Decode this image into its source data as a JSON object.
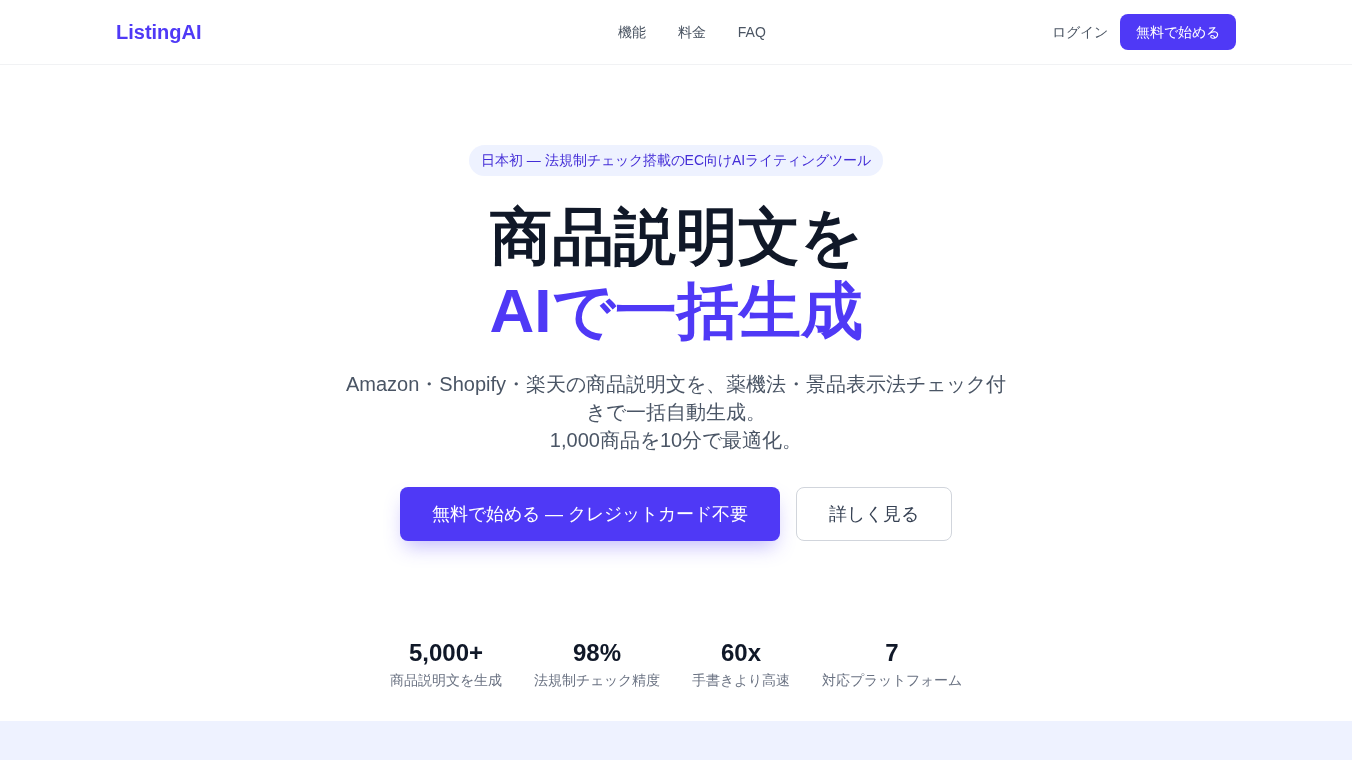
{
  "header": {
    "logo": "ListingAI",
    "nav": [
      "機能",
      "料金",
      "FAQ"
    ],
    "login": "ログイン",
    "cta": "無料で始める"
  },
  "hero": {
    "badge": "日本初 — 法規制チェック搭載のEC向けAIライティングツール",
    "heading": [
      {
        "text": "商品説明文を",
        "accent": false
      },
      {
        "text": "AIで一括生成",
        "accent": true
      }
    ],
    "subtitle": [
      "Amazon・Shopify・楽天の商品説明文を、薬機法・景品表示法チェック付きで一括自動生成。",
      "1,000商品を10分で最適化。"
    ],
    "buttons": [
      {
        "label": "無料で始める — クレジットカード不要",
        "kind": "primary"
      },
      {
        "label": "詳しく見る",
        "kind": "secondary"
      }
    ]
  },
  "stats": [
    {
      "value": "5,000+",
      "label": "商品説明文を生成"
    },
    {
      "value": "98%",
      "label": "法規制チェック精度"
    },
    {
      "value": "60x",
      "label": "手書きより高速"
    },
    {
      "value": "7",
      "label": "対応プラットフォーム"
    }
  ]
}
